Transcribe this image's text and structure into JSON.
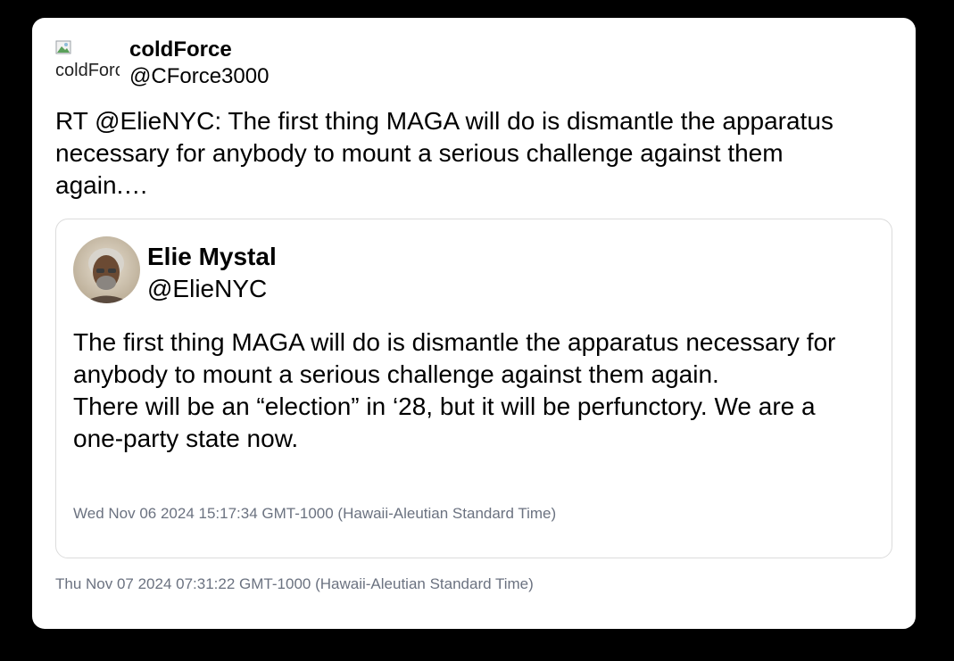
{
  "tweet": {
    "avatar_alt": "coldForce",
    "display_name": "coldForce",
    "handle": "@CForce3000",
    "text": "RT @ElieNYC: The first thing MAGA will do is dismantle the apparatus necessary for anybody to mount a serious challenge against them again.…",
    "timestamp": "Thu Nov 07 2024 07:31:22 GMT-1000 (Hawaii-Aleutian Standard Time)"
  },
  "quoted": {
    "display_name": "Elie Mystal",
    "handle": "@ElieNYC",
    "text_line1": "The first thing MAGA will do is dismantle the apparatus necessary for anybody to mount a serious challenge against them again.",
    "text_line2": "There will be an “election” in ‘28, but it will be perfunctory. We are a one-party state now.",
    "timestamp": "Wed Nov 06 2024 15:17:34 GMT-1000 (Hawaii-Aleutian Standard Time)"
  },
  "icons": {
    "broken_image": "broken-image-icon",
    "quoted_avatar": "avatar-photo"
  },
  "colors": {
    "background": "#000000",
    "card": "#ffffff",
    "text": "#000000",
    "muted": "#6b7280",
    "border": "#dcdcdc"
  }
}
